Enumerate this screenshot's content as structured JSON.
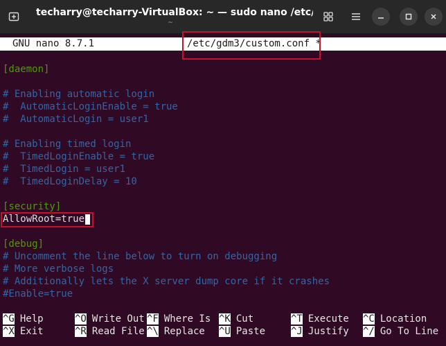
{
  "window": {
    "title": "techarry@techarry-VirtualBox: ~ — sudo nano /etc/g...",
    "subtitle": "~"
  },
  "icons": {
    "new_tab": "new-tab-icon",
    "grid": "grid-icon",
    "menu": "hamburger-menu-icon",
    "minimize": "minimize-icon",
    "maximize": "maximize-icon",
    "close": "close-icon"
  },
  "nano": {
    "version": "GNU nano 8.7.1",
    "filename": "/etc/gdm3/custom.conf *"
  },
  "lines": [
    {
      "text": "[daemon]",
      "type": "section"
    },
    {
      "text": "",
      "type": "plain"
    },
    {
      "text": "# Enabling automatic login",
      "type": "comment"
    },
    {
      "text": "#  AutomaticLoginEnable = true",
      "type": "comment"
    },
    {
      "text": "#  AutomaticLogin = user1",
      "type": "comment"
    },
    {
      "text": "",
      "type": "plain"
    },
    {
      "text": "# Enabling timed login",
      "type": "comment"
    },
    {
      "text": "#  TimedLoginEnable = true",
      "type": "comment"
    },
    {
      "text": "#  TimedLogin = user1",
      "type": "comment"
    },
    {
      "text": "#  TimedLoginDelay = 10",
      "type": "comment"
    },
    {
      "text": "",
      "type": "plain"
    },
    {
      "text": "[security]",
      "type": "section"
    },
    {
      "text": "AllowRoot=true",
      "type": "plain"
    },
    {
      "text": "",
      "type": "plain"
    },
    {
      "text": "[debug]",
      "type": "section"
    },
    {
      "text": "# Uncomment the line below to turn on debugging",
      "type": "comment"
    },
    {
      "text": "# More verbose logs",
      "type": "comment"
    },
    {
      "text": "# Additionally lets the X server dump core if it crashes",
      "type": "comment"
    },
    {
      "text": "#Enable=true",
      "type": "comment"
    }
  ],
  "shortcuts": [
    {
      "key": "^G",
      "label": "Help"
    },
    {
      "key": "^X",
      "label": "Exit"
    },
    {
      "key": "^O",
      "label": "Write Out"
    },
    {
      "key": "^R",
      "label": "Read File"
    },
    {
      "key": "^F",
      "label": "Where Is"
    },
    {
      "key": "^\\",
      "label": "Replace"
    },
    {
      "key": "^K",
      "label": "Cut"
    },
    {
      "key": "^U",
      "label": "Paste"
    },
    {
      "key": "^T",
      "label": "Execute"
    },
    {
      "key": "^J",
      "label": "Justify"
    },
    {
      "key": "^C",
      "label": "Location"
    },
    {
      "key": "^/",
      "label": "Go To Line"
    }
  ],
  "colors": {
    "terminal_bg": "#300a24",
    "section": "#4e9a06",
    "comment": "#3465a4",
    "annotation": "#c8102e"
  }
}
